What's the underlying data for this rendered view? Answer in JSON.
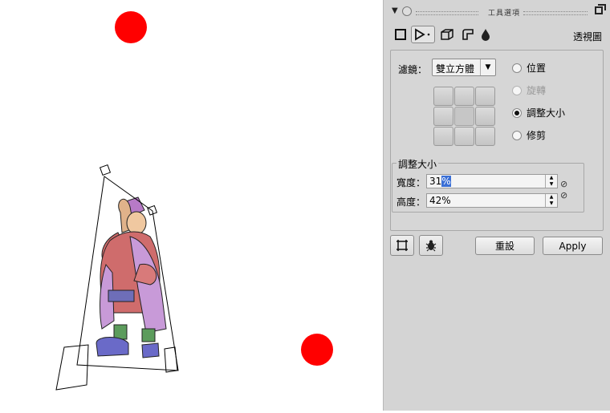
{
  "panel": {
    "title": "工具選項",
    "view_label": "透視圖",
    "tools": [
      {
        "icon": "rectangle-select-icon"
      },
      {
        "icon": "transform-tool-icon"
      },
      {
        "icon": "cube-icon"
      },
      {
        "icon": "shape-icon"
      },
      {
        "icon": "drop-icon"
      }
    ],
    "filter_label": "濾鏡：",
    "filter_value": "雙立方體",
    "radios": [
      {
        "label": "位置",
        "checked": false,
        "disabled": false
      },
      {
        "label": "旋轉",
        "checked": false,
        "disabled": true
      },
      {
        "label": "調整大小",
        "checked": true,
        "disabled": false
      },
      {
        "label": "修剪",
        "checked": false,
        "disabled": false
      }
    ],
    "resize_group_title": "調整大小",
    "width_label": "寬度：",
    "width_value_sel": "31",
    "width_value_rest": "%",
    "height_label": "高度：",
    "height_value": "42%",
    "reset_label": "重設",
    "apply_label": "Apply"
  },
  "canvas": {
    "dot_color": "#ff0000",
    "outline_color": "#000000"
  }
}
